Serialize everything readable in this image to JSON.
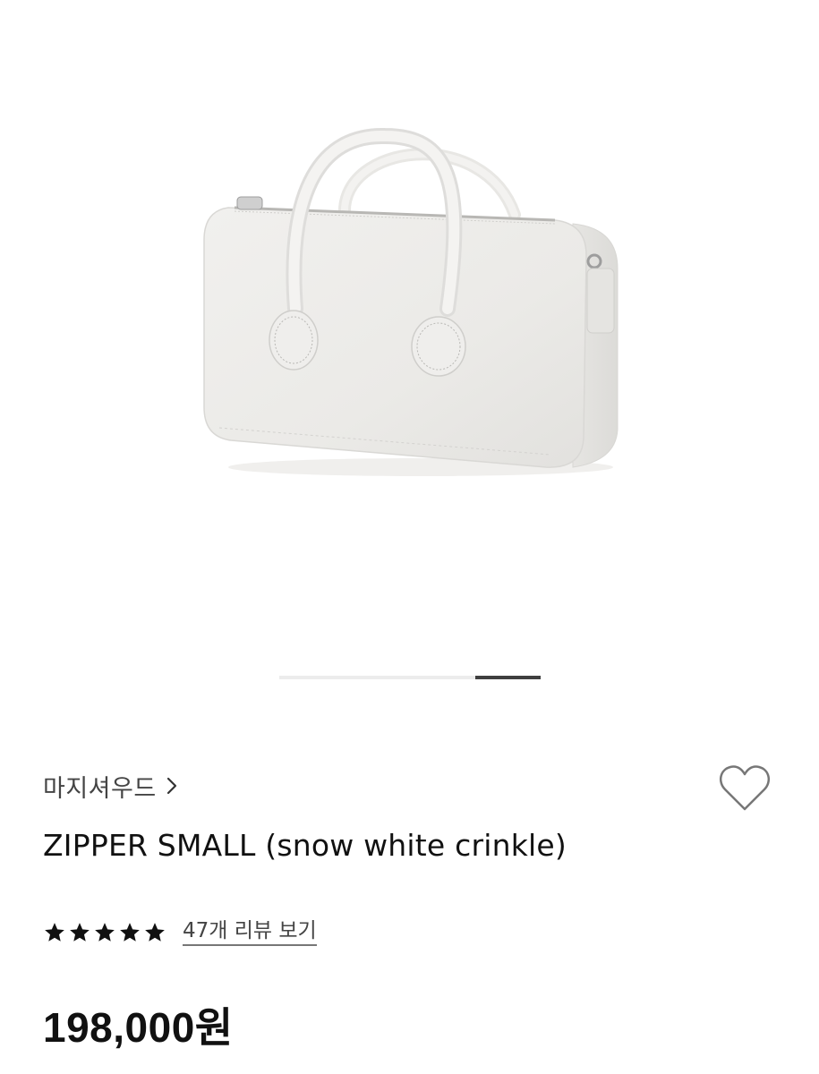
{
  "gallery": {
    "image_alt": "ZIPPER SMALL (snow white crinkle) product image",
    "slide_progress": {
      "current": 4,
      "total": 4
    }
  },
  "product": {
    "brand": "마지셔우드",
    "title": "ZIPPER SMALL (snow white crinkle)",
    "rating": 5,
    "review_link": "47개 리뷰 보기",
    "price": "198,000원"
  },
  "icons": {
    "brand_chevron": "chevron-right-icon",
    "wishlist": "heart-outline-icon",
    "rating_star": "star-filled-icon"
  },
  "colors": {
    "text": "#111111",
    "muted": "#444444",
    "pager_active": "#3f3f3f",
    "pager_track": "#ececec"
  }
}
